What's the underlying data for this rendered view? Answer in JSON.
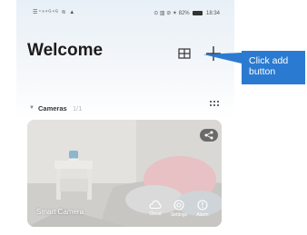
{
  "statusbar": {
    "left_text": "☰⁺ᵉ⁴ᴳ⁴ᴳ ≋ ▲",
    "right_text": "⊙ ▥ ⊘ ✶ 82%",
    "time": "18:34"
  },
  "header": {
    "title": "Welcome"
  },
  "callout": {
    "text": "Click add button"
  },
  "section": {
    "label": "Cameras",
    "count": "1/1"
  },
  "camera": {
    "name": "Smart Camera",
    "actions": [
      "Cloud",
      "Settings",
      "Alarm"
    ]
  },
  "colors": {
    "callout_bg": "#2b7ad1",
    "title": "#1c1c1c"
  }
}
